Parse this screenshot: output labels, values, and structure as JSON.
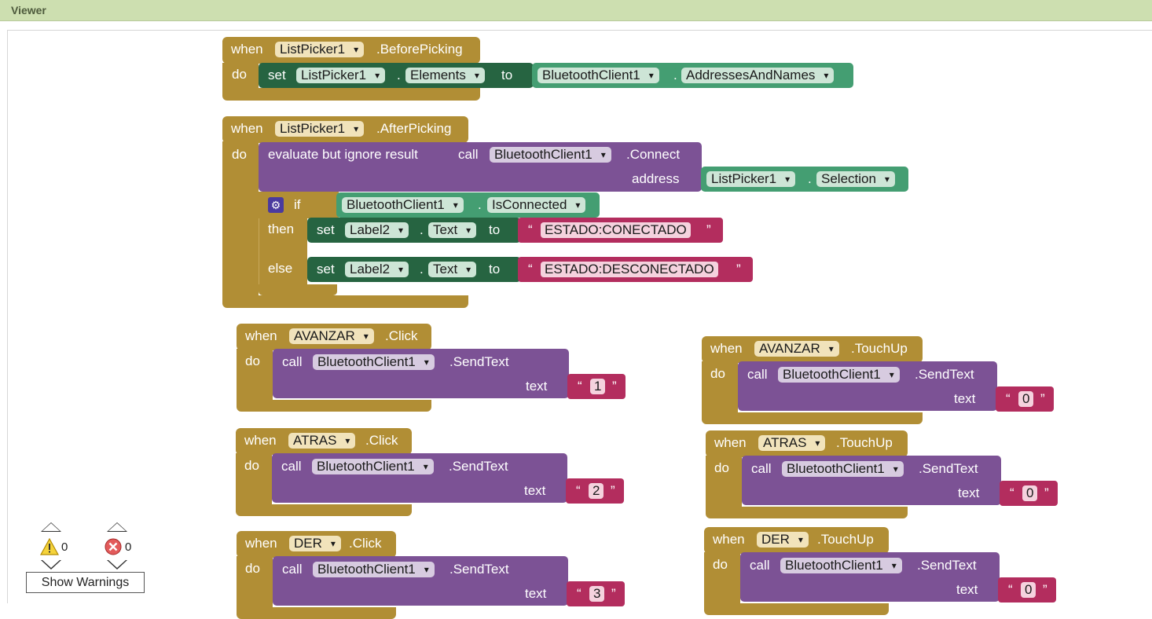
{
  "viewer": {
    "title": "Viewer"
  },
  "blocks": {
    "when": "when",
    "do": "do",
    "set": "set",
    "to": "to",
    "call": "call",
    "dot": ".",
    "if": "if",
    "then": "then",
    "else": "else",
    "text_param": "text",
    "address_param": "address",
    "evaluate": "evaluate but ignore result",
    "quote_open": "“",
    "quote_close": "”",
    "before_picking": {
      "component": "ListPicker1",
      "event": ".BeforePicking",
      "set_component": "ListPicker1",
      "set_property": "Elements",
      "value_component": "BluetoothClient1",
      "value_property": "AddressesAndNames"
    },
    "after_picking": {
      "component": "ListPicker1",
      "event": ".AfterPicking",
      "call_component": "BluetoothClient1",
      "call_method": ".Connect",
      "address_component": "ListPicker1",
      "address_property": "Selection",
      "if_component": "BluetoothClient1",
      "if_property": "IsConnected",
      "then_component": "Label2",
      "then_property": "Text",
      "then_value": "ESTADO:CONECTADO",
      "else_component": "Label2",
      "else_property": "Text",
      "else_value": "ESTADO:DESCONECTADO"
    },
    "avanzar_click": {
      "component": "AVANZAR",
      "event": ".Click",
      "call_component": "BluetoothClient1",
      "method": ".SendText",
      "value": "1"
    },
    "atras_click": {
      "component": "ATRAS",
      "event": ".Click",
      "call_component": "BluetoothClient1",
      "method": ".SendText",
      "value": "2"
    },
    "der_click": {
      "component": "DER",
      "event": ".Click",
      "call_component": "BluetoothClient1",
      "method": ".SendText",
      "value": "3"
    },
    "avanzar_touchup": {
      "component": "AVANZAR",
      "event": ".TouchUp",
      "call_component": "BluetoothClient1",
      "method": ".SendText",
      "value": "0"
    },
    "atras_touchup": {
      "component": "ATRAS",
      "event": ".TouchUp",
      "call_component": "BluetoothClient1",
      "method": ".SendText",
      "value": "0"
    },
    "der_touchup": {
      "component": "DER",
      "event": ".TouchUp",
      "call_component": "BluetoothClient1",
      "method": ".SendText",
      "value": "0"
    }
  },
  "warnings": {
    "warning_count": "0",
    "error_count": "0",
    "show_warnings_label": "Show Warnings"
  },
  "colors": {
    "event_block": "#b18e35",
    "procedure_block": "#7c5295",
    "setter_block": "#266441",
    "getter_block": "#449e72",
    "text_block": "#b32d5e",
    "header": "#cddfb0"
  }
}
